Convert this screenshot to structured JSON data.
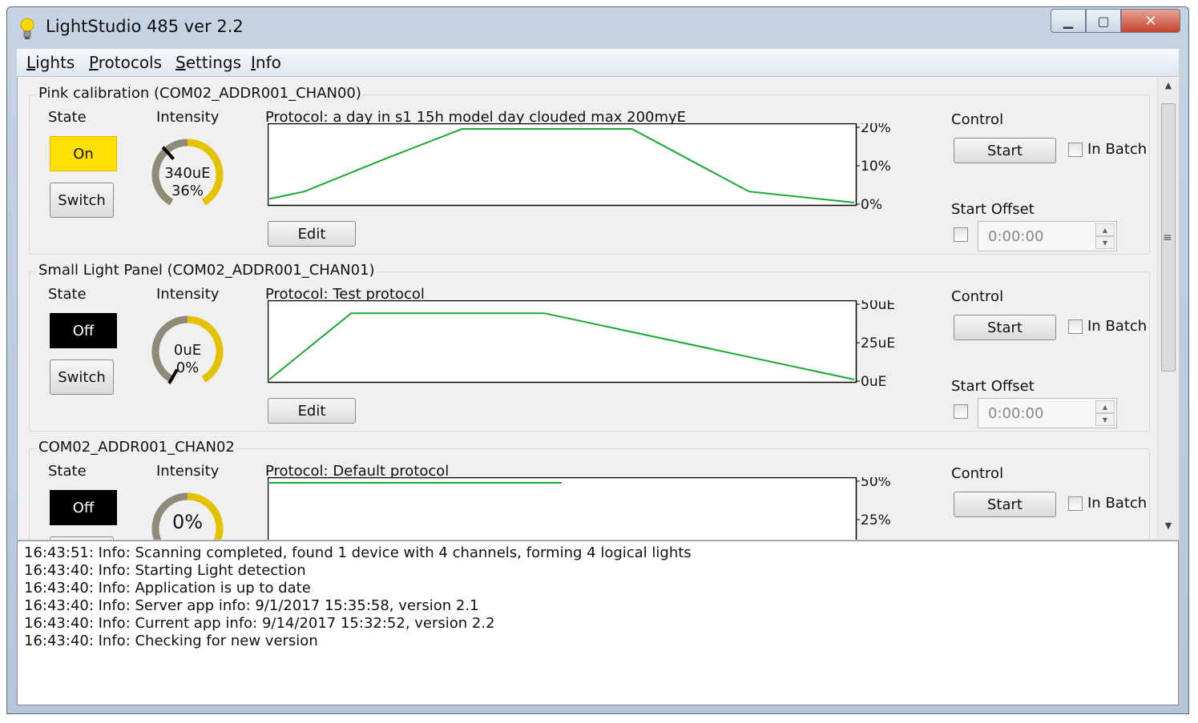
{
  "window": {
    "title": "LightStudio 485 ver 2.2"
  },
  "menu": [
    {
      "label": "Lights",
      "accel": "L",
      "rest": "ights"
    },
    {
      "label": "Protocols",
      "accel": "P",
      "rest": "rotocols"
    },
    {
      "label": "Settings",
      "accel": "S",
      "rest": "ettings"
    },
    {
      "label": "Info",
      "accel": "I",
      "rest": "nfo"
    }
  ],
  "colors": {
    "on": "#ffe000",
    "off": "#000000",
    "gauge_ring": "#e5c200",
    "gauge_ring_dark": "#8f8b78",
    "chart_line": "#1aa832"
  },
  "lights": [
    {
      "title": "Pink calibration (COM02_ADDR001_CHAN00)",
      "state_label": "State",
      "intensity_label": "Intensity",
      "state": "On",
      "switch_label": "Switch",
      "intensity_value": "340uE",
      "intensity_percent": "36%",
      "intensity_fraction": 0.36,
      "protocol": "Protocol: a day in s1 15h model day clouded max 200myE",
      "edit_label": "Edit",
      "control_label": "Control",
      "start_label": "Start",
      "in_batch_label": "In Batch",
      "start_offset_label": "Start Offset",
      "start_offset_value": "0:00:00",
      "chart_data": {
        "type": "line",
        "x": [
          0,
          0.06,
          0.2,
          0.33,
          0.62,
          0.82,
          1.0
        ],
        "y": [
          1,
          3,
          12,
          20,
          20,
          3,
          0
        ],
        "ylim": [
          0,
          20
        ],
        "ytick_labels": [
          "20%",
          "10%",
          "0%"
        ]
      }
    },
    {
      "title": "Small Light Panel (COM02_ADDR001_CHAN01)",
      "state_label": "State",
      "intensity_label": "Intensity",
      "state": "Off",
      "switch_label": "Switch",
      "intensity_value": "0uE",
      "intensity_percent": "0%",
      "intensity_fraction": 0.0,
      "protocol": "Protocol: Test protocol",
      "edit_label": "Edit",
      "control_label": "Control",
      "start_label": "Start",
      "in_batch_label": "In Batch",
      "start_offset_label": "Start Offset",
      "start_offset_value": "0:00:00",
      "chart_data": {
        "type": "line",
        "x": [
          0,
          0.14,
          0.47,
          1.0
        ],
        "y": [
          0,
          45,
          45,
          0
        ],
        "ylim": [
          0,
          50
        ],
        "ytick_labels": [
          "50uE",
          "25uE",
          "0uE"
        ]
      }
    },
    {
      "title": "COM02_ADDR001_CHAN02",
      "state_label": "State",
      "intensity_label": "Intensity",
      "state": "Off",
      "intensity_percent": "0%",
      "intensity_fraction": 0.0,
      "protocol": "Protocol: Default protocol",
      "control_label": "Control",
      "start_label": "Start",
      "in_batch_label": "In Batch",
      "chart_data": {
        "type": "line",
        "x": [
          0,
          0.5
        ],
        "y": [
          50,
          50
        ],
        "ylim": [
          0,
          50
        ],
        "ytick_labels": [
          "50%",
          "25%"
        ]
      }
    }
  ],
  "log": [
    "16:43:51: Info: Scanning completed, found 1 device with 4 channels, forming 4 logical lights",
    "16:43:40: Info: Starting Light detection",
    "16:43:40: Info: Application is up to date",
    "16:43:40: Info: Server app info: 9/1/2017 15:35:58, version 2.1",
    "16:43:40: Info: Current app info: 9/14/2017 15:32:52, version 2.2",
    "16:43:40: Info: Checking for new version"
  ]
}
